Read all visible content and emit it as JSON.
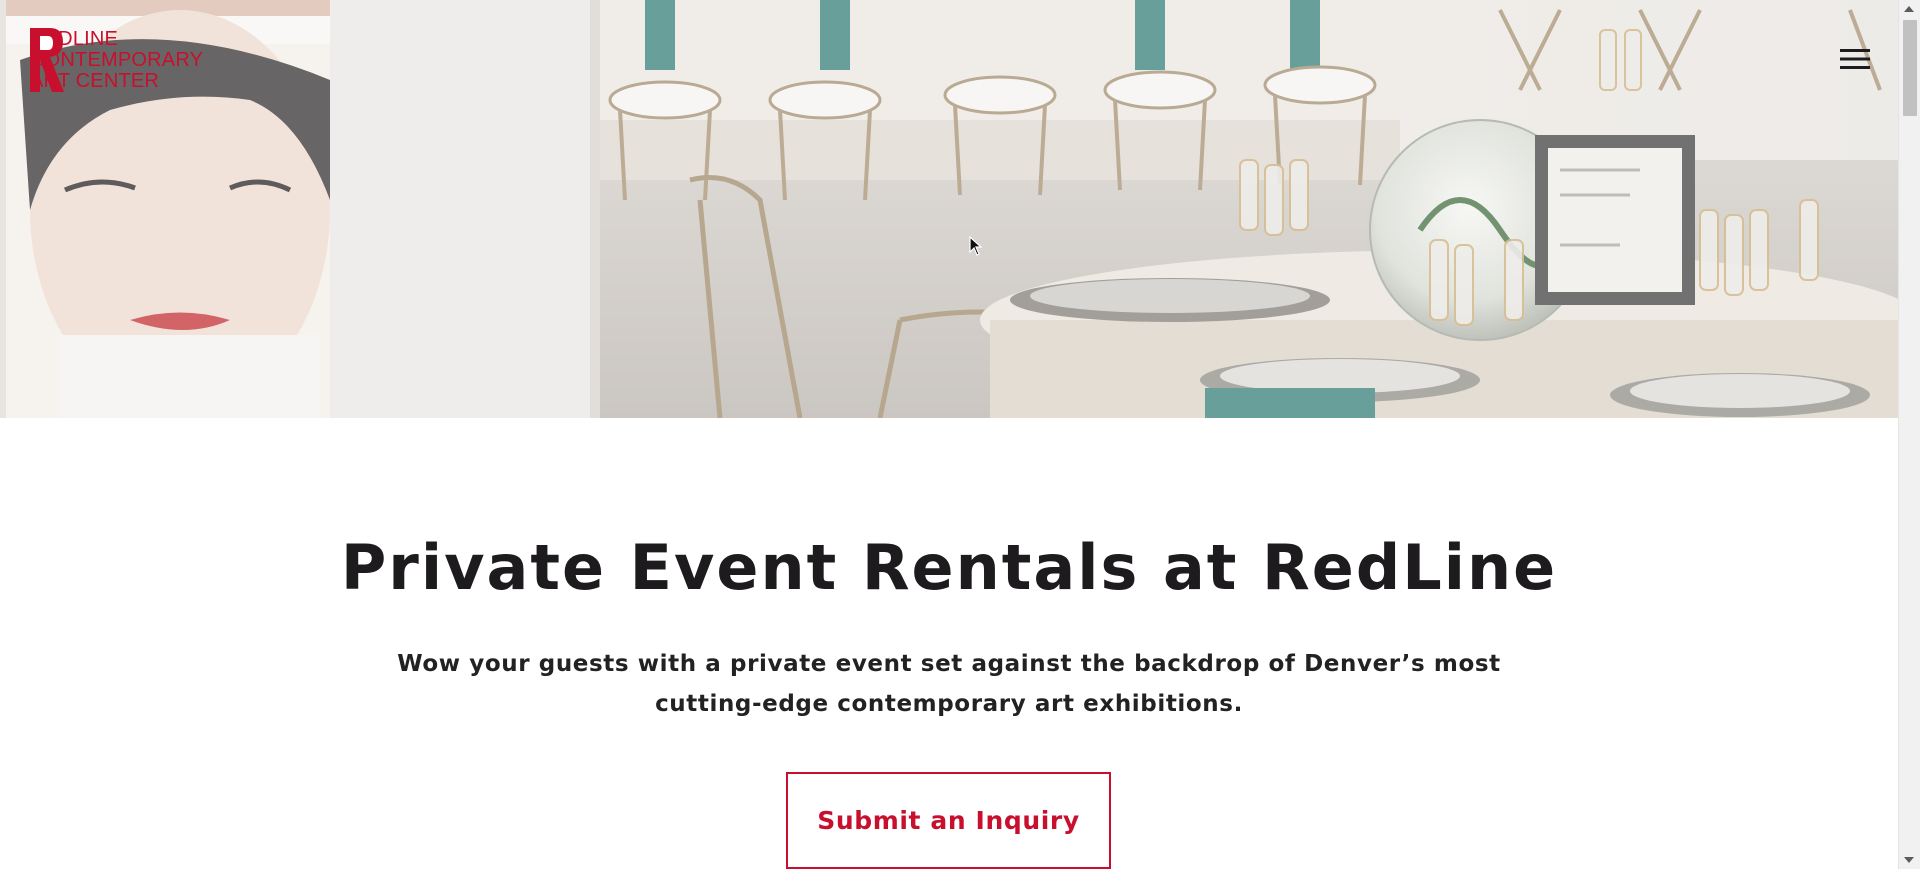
{
  "brand": {
    "logo_lines": [
      "REDLINE",
      "CONTEMPORARY",
      "ART CENTER"
    ],
    "accent_color": "#c8102e"
  },
  "header": {
    "menu_icon": "hamburger-menu-icon"
  },
  "hero": {
    "image_description_icon": "event-venue-photo"
  },
  "main": {
    "title": "Private Event Rentals at RedLine",
    "intro": "Wow your guests with a private event set against the backdrop of Denver’s most cutting-edge contemporary art exhibitions.",
    "cta_label": "Submit an Inquiry"
  },
  "colors": {
    "accent": "#c8102e",
    "text": "#1e1b1f",
    "background": "#ffffff"
  }
}
